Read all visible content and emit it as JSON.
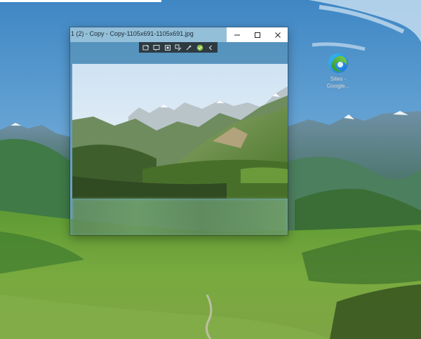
{
  "window": {
    "title": "1 (2) - Copy - Copy-1105x691-1105x691.jpg",
    "caption": {
      "minimize": "minimize-icon",
      "maximize": "maximize-icon",
      "close": "close-icon"
    },
    "toolbar_icons": [
      "enhance-icon",
      "rotate-icon",
      "crop-icon",
      "edit-icon",
      "magic-icon",
      "check-icon",
      "chevron-icon"
    ]
  },
  "desktop_icon": {
    "icon": "edge-icon",
    "label_line1": "Sites -",
    "label_line2": "Google..."
  },
  "colors": {
    "sky": "#4d93cc",
    "window_tint": "#5c96b4",
    "toolbar": "#2e3a42",
    "caption_bar": "#ffffff",
    "meadow": "#6b9c3a"
  }
}
